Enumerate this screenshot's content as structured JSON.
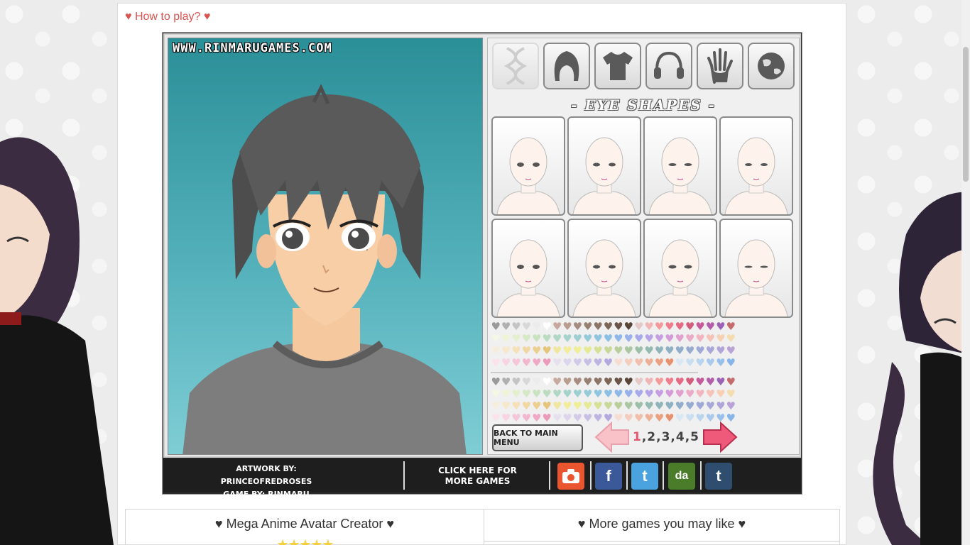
{
  "header": {
    "how_to_play": "♥ How to play? ♥"
  },
  "game": {
    "watermark": "WWW.RINMARUGAMES.COM",
    "categories": [
      {
        "name": "dna",
        "icon": "dna-icon"
      },
      {
        "name": "hair",
        "icon": "hair-icon"
      },
      {
        "name": "shirt",
        "icon": "shirt-icon"
      },
      {
        "name": "headphones",
        "icon": "headphones-icon"
      },
      {
        "name": "hand",
        "icon": "hand-icon"
      },
      {
        "name": "globe",
        "icon": "globe-icon"
      }
    ],
    "section_title": "- EYE SHAPES -",
    "back_button": "BACK TO MAIN MENU",
    "pages": {
      "current": "1",
      "rest": ",2,3,4,5"
    },
    "credits_artwork": "ARTWORK BY: PRINCEOFREDROSES",
    "credits_game": "GAME BY: RINMARU",
    "more_games_line1": "CLICK HERE FOR",
    "more_games_line2": "MORE GAMES",
    "social": [
      {
        "name": "camera",
        "label": "",
        "color": "#e8552f"
      },
      {
        "name": "facebook",
        "label": "f",
        "color": "#3b5998"
      },
      {
        "name": "twitter",
        "label": "t",
        "color": "#4aa3df"
      },
      {
        "name": "deviantart",
        "label": "da",
        "color": "#4a7c2a"
      },
      {
        "name": "tumblr",
        "label": "t",
        "color": "#2f4e6f"
      }
    ],
    "heart_colors_a": [
      "#9a9a9a",
      "#b0b0b0",
      "#c4c4c4",
      "#d8d8d8",
      "#ececec",
      "#ffffff",
      "#c7a9a0",
      "#b99d8f",
      "#a88c80",
      "#978072",
      "#8c7566",
      "#7d6658",
      "#6b5549",
      "#5a4539",
      "#e5c8c8",
      "#f2b5b5",
      "#f59a9a",
      "#ef7e8d",
      "#e66a83",
      "#d35c7d",
      "#c65a9a",
      "#b35eaa",
      "#9c62b6",
      "#c46b6b"
    ],
    "heart_colors_b": [
      "#f3f7e3",
      "#eef4d5",
      "#e3efcd",
      "#d6e9c6",
      "#c9e3c0",
      "#bbdcc0",
      "#b0d7c6",
      "#a6d3cc",
      "#9dcfd3",
      "#95cbd9",
      "#8fc5df",
      "#8bbfe4",
      "#8fb8e8",
      "#98b1ea",
      "#a6aaea",
      "#b5a4e7",
      "#c59fe1",
      "#d39bd8",
      "#e0a1cf",
      "#ebaac6",
      "#f2b5bf",
      "#f6c2b8",
      "#f7cfb2",
      "#f5dcae"
    ],
    "heart_colors_c": [
      "#f6eedd",
      "#f7e8cc",
      "#f5e0b7",
      "#f1d7a2",
      "#ecce8e",
      "#e6c47a",
      "#f1e6a0",
      "#f2ec9c",
      "#efef98",
      "#e4ea96",
      "#d6e196",
      "#c7d898",
      "#b8cf9c",
      "#aac6a2",
      "#9dbfa9",
      "#94b9b1",
      "#8fb4ba",
      "#8eb0c3",
      "#91adca",
      "#97abd1",
      "#9ea9d6",
      "#a7a7d8",
      "#b0a5d8",
      "#b9a3d6"
    ],
    "heart_colors_d": [
      "#fbe3ec",
      "#f8d4e2",
      "#f5c5d8",
      "#f2b6ce",
      "#efa8c5",
      "#ec9abc",
      "#e6e0ee",
      "#dcd5eb",
      "#d2cae8",
      "#c8bfe5",
      "#beb4e2",
      "#b4a9df",
      "#f6dcd1",
      "#f3cdbd",
      "#f0bea9",
      "#edaf95",
      "#eaa081",
      "#e7916d",
      "#d9e8f2",
      "#c9def0",
      "#b9d4ee",
      "#a9caec",
      "#99c0ea",
      "#89b6e8"
    ]
  },
  "info": {
    "left_title": "♥ Mega Anime Avatar Creator ♥",
    "stars": "★★★★★",
    "right_title": "♥ More games you may like ♥"
  }
}
